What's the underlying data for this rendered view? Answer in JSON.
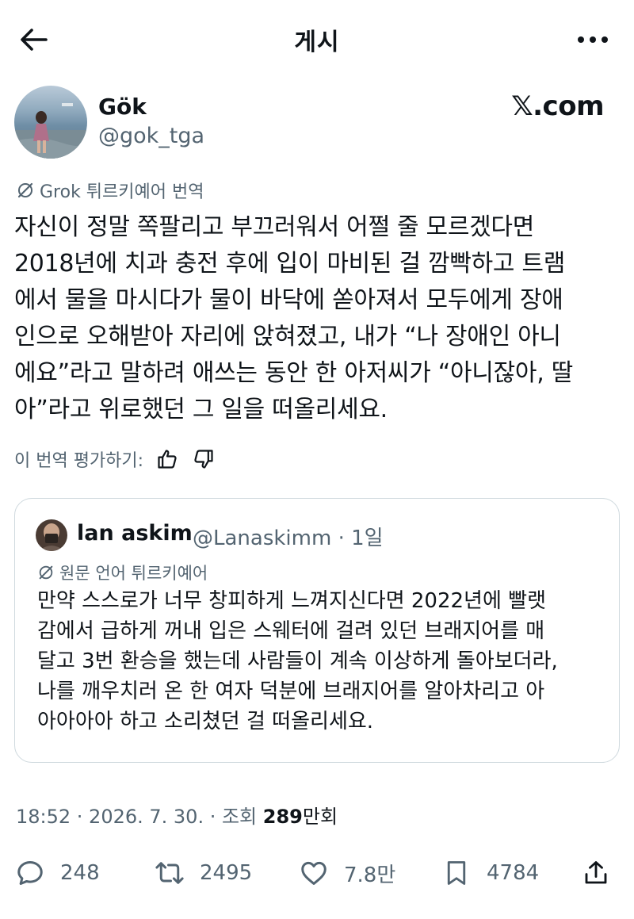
{
  "header": {
    "title": "게시"
  },
  "author": {
    "name": "Gök",
    "handle": "@gok_tga"
  },
  "source": {
    "label": "𝕏.com"
  },
  "translation": {
    "label": "Grok 튀르키예어 번역"
  },
  "tweet": {
    "lines": [
      "자신이 정말 쪽팔리고 부끄러워서 어쩔 줄 모르겠다면",
      "2018년에 치과 충전 후에 입이 마비된 걸 깜빡하고 트램",
      "에서 물을 마시다가 물이 바닥에 쏟아져서 모두에게 장애",
      "인으로 오해받아 자리에 앉혀졌고, 내가 “나 장애인 아니",
      "에요”라고 말하려 애쓰는 동안 한 아저씨가 “아니잖아, 딸",
      "아”라고 위로했던 그 일을 떠올리세요."
    ]
  },
  "rate": {
    "label": "이 번역 평가하기:"
  },
  "quote": {
    "name": "lan askim",
    "meta": "@Lanaskimm · 1일",
    "lang": "원문 언어 튀르키예어",
    "lines": [
      "만약 스스로가 너무 창피하게 느껴지신다면 2022년에 빨랫",
      "감에서 급하게 꺼내 입은 스웨터에 걸려 있던 브래지어를 매",
      "달고 3번 환승을 했는데 사람들이 계속 이상하게 돌아보더라,",
      "나를 깨우치러 온 한 여자 덕분에 브래지어를 알아차리고 아",
      "아아아아 하고 소리쳤던 걸 떠올리세요."
    ]
  },
  "meta": {
    "time": "18:52 · 2026. 7. 30. · 조회 ",
    "views": "289",
    "views_unit": "만회"
  },
  "actions": {
    "replies": "248",
    "reposts": "2495",
    "likes": "7.8만",
    "bookmarks": "4784"
  },
  "colors": {
    "text": "#0f1419",
    "secondary": "#536471",
    "border": "#cfd9de"
  }
}
